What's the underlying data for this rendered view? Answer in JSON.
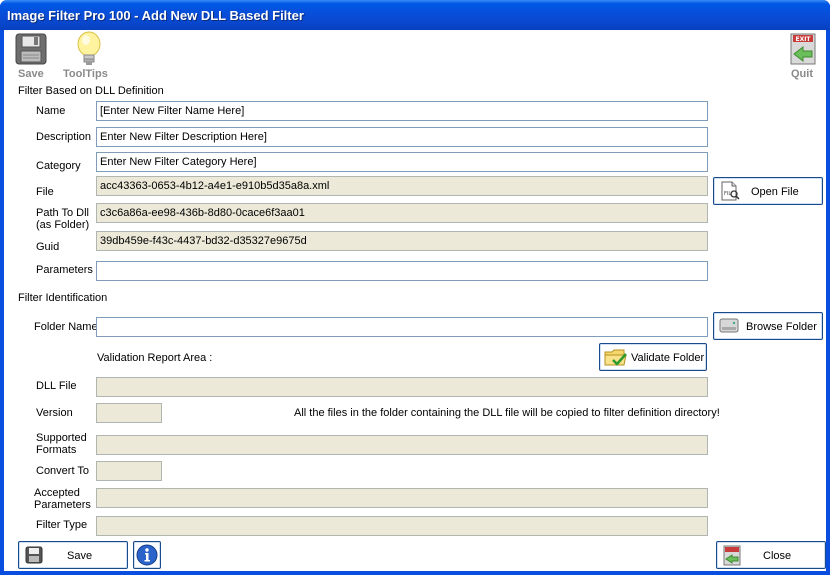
{
  "window": {
    "title": "Image Filter Pro 100 -  Add New DLL Based Filter"
  },
  "toolbar": {
    "save_label": "Save",
    "tooltips_label": "ToolTips",
    "quit_label": "Quit"
  },
  "section1": {
    "heading": "Filter Based on DLL Definition",
    "name_label": "Name",
    "name_value": "[Enter New Filter Name Here]",
    "description_label": "Description",
    "description_value": "Enter New Filter Description Here]",
    "category_label": "Category",
    "category_value": "Enter New Filter Category Here]",
    "file_label": "File",
    "file_value": "acc43363-0653-4b12-a4e1-e910b5d35a8a.xml",
    "path_label": "Path To Dll (as Folder)",
    "path_value": "c3c6a86a-ee98-436b-8d80-0cace6f3aa01",
    "guid_label": "Guid",
    "guid_value": "39db459e-f43c-4437-bd32-d35327e9675d",
    "parameters_label": "Parameters",
    "parameters_value": "",
    "open_file_label": "Open File"
  },
  "section2": {
    "heading": "Filter Identification",
    "folder_label": "Folder Name",
    "folder_value": "",
    "browse_label": "Browse Folder",
    "validation_label": "Validation Report Area :",
    "validate_label": "Validate Folder",
    "dll_file_label": "DLL File",
    "version_label": "Version",
    "copy_note": "All the files in the folder containing the DLL file will be copied to filter definition directory!",
    "formats_label": "Supported Formats",
    "convert_label": "Convert To",
    "accepted_label": "Accepted Parameters",
    "filter_type_label": "Filter Type"
  },
  "footer": {
    "save_label": "Save",
    "close_label": "Close"
  },
  "colors": {
    "titlebar": "#0a4ee0",
    "readonly_bg": "#ece9d8",
    "field_border": "#7f9db9",
    "toolbar_label": "#8a8a8a"
  }
}
